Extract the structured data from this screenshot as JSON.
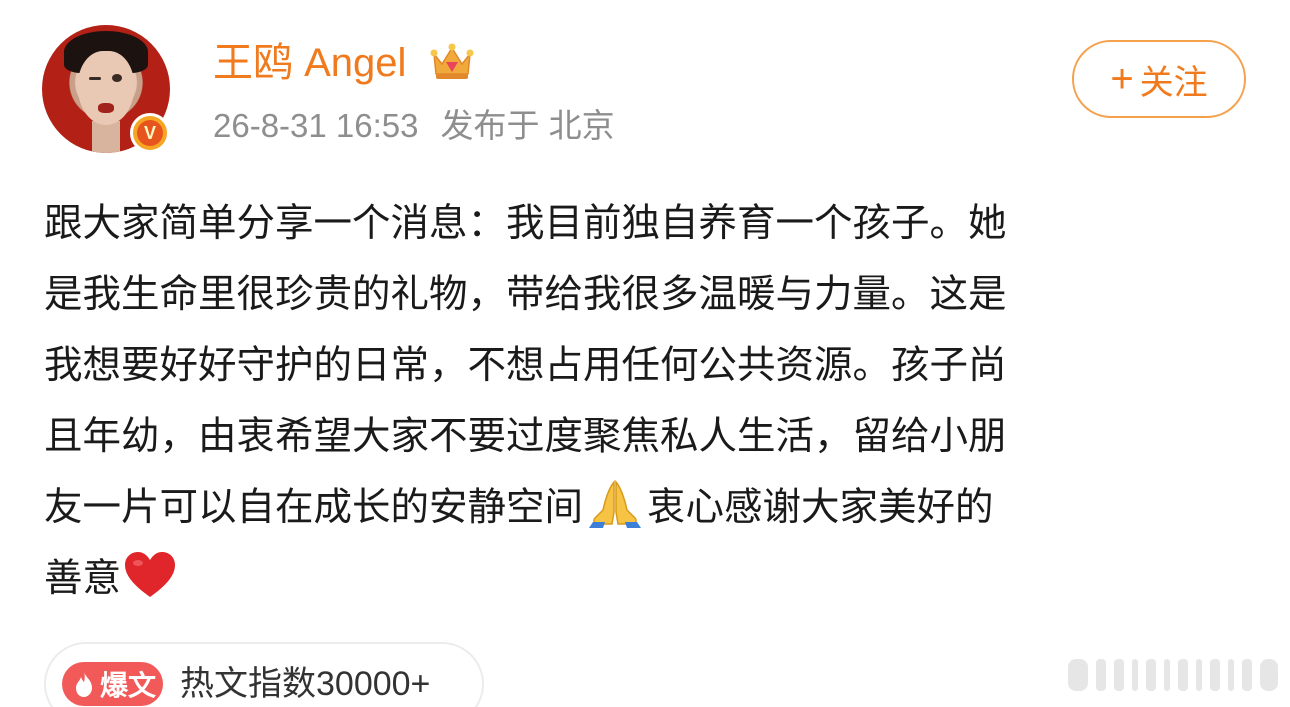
{
  "post": {
    "author": "王鸥 Angel",
    "timestamp": "26-8-31 16:53",
    "location": "发布于 北京",
    "follow_label": "关注",
    "follow_plus": "+",
    "lines": [
      "跟大家简单分享一个消息：我目前独自养育一个孩子。她",
      "是我生命里很珍贵的礼物，带给我很多温暖与力量。这是",
      "我想要好好守护的日常，不想占用任何公共资源。孩子尚",
      "且年幼，由衷希望大家不要过度聚焦私人生活，留给小朋"
    ],
    "line5_before": "友一片可以自在成长的安静空间",
    "line5_after": "衷心感谢大家美好的",
    "line6": "善意"
  },
  "hot": {
    "tag": "爆文",
    "text": "热文指数30000+"
  },
  "icons": {
    "verified": "verified-v-icon",
    "crown": "crown-icon",
    "pray": "folded-hands-emoji",
    "heart": "red-heart-emoji",
    "flame": "flame-icon"
  },
  "colors": {
    "username": "#f07a1e",
    "meta": "#8e8e8e",
    "hot_tag": "#f25a5a",
    "follow_border": "#f5a14d"
  }
}
